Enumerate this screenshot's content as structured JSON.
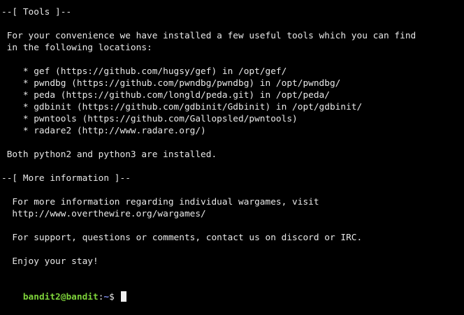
{
  "terminal": {
    "lines": [
      "--[ Tools ]--",
      "",
      " For your convenience we have installed a few useful tools which you can find",
      " in the following locations:",
      "",
      "    * gef (https://github.com/hugsy/gef) in /opt/gef/",
      "    * pwndbg (https://github.com/pwndbg/pwndbg) in /opt/pwndbg/",
      "    * peda (https://github.com/longld/peda.git) in /opt/peda/",
      "    * gdbinit (https://github.com/gdbinit/Gdbinit) in /opt/gdbinit/",
      "    * pwntools (https://github.com/Gallopsled/pwntools)",
      "    * radare2 (http://www.radare.org/)",
      "",
      " Both python2 and python3 are installed.",
      "",
      "--[ More information ]--",
      "",
      "  For more information regarding individual wargames, visit",
      "  http://www.overthewire.org/wargames/",
      "",
      "  For support, questions or comments, contact us on discord or IRC.",
      "",
      "  Enjoy your stay!"
    ],
    "prompt": {
      "user_host": "bandit2@bandit",
      "separator": ":",
      "path": "~",
      "symbol": "$ "
    },
    "colors": {
      "background": "#000000",
      "text": "#e8e8e8",
      "user_host": "#7dd23a",
      "path": "#7f8ff0"
    }
  }
}
